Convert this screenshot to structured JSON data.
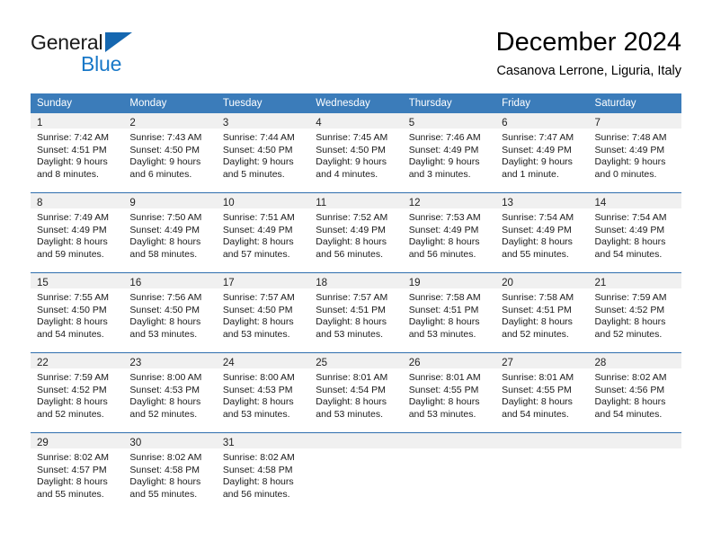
{
  "brand": {
    "word_one": "General",
    "word_two": "Blue",
    "triangle_icon": "triangle-logo-icon",
    "color_dark": "#1a1a1a",
    "color_blue": "#1878c8",
    "color_triangle": "#1567b0"
  },
  "header": {
    "title": "December 2024",
    "subtitle": "Casanova Lerrone, Liguria, Italy"
  },
  "theme": {
    "header_bg": "#3b7cba",
    "header_text": "#ffffff",
    "daynum_band_bg": "#f0f0f0",
    "row_divider": "#2f6fae",
    "cell_bg": "#ffffff"
  },
  "calendar": {
    "weekday_headers": [
      "Sunday",
      "Monday",
      "Tuesday",
      "Wednesday",
      "Thursday",
      "Friday",
      "Saturday"
    ],
    "weeks": [
      [
        {
          "day": "1",
          "sunrise": "Sunrise: 7:42 AM",
          "sunset": "Sunset: 4:51 PM",
          "daylight": "Daylight: 9 hours and 8 minutes."
        },
        {
          "day": "2",
          "sunrise": "Sunrise: 7:43 AM",
          "sunset": "Sunset: 4:50 PM",
          "daylight": "Daylight: 9 hours and 6 minutes."
        },
        {
          "day": "3",
          "sunrise": "Sunrise: 7:44 AM",
          "sunset": "Sunset: 4:50 PM",
          "daylight": "Daylight: 9 hours and 5 minutes."
        },
        {
          "day": "4",
          "sunrise": "Sunrise: 7:45 AM",
          "sunset": "Sunset: 4:50 PM",
          "daylight": "Daylight: 9 hours and 4 minutes."
        },
        {
          "day": "5",
          "sunrise": "Sunrise: 7:46 AM",
          "sunset": "Sunset: 4:49 PM",
          "daylight": "Daylight: 9 hours and 3 minutes."
        },
        {
          "day": "6",
          "sunrise": "Sunrise: 7:47 AM",
          "sunset": "Sunset: 4:49 PM",
          "daylight": "Daylight: 9 hours and 1 minute."
        },
        {
          "day": "7",
          "sunrise": "Sunrise: 7:48 AM",
          "sunset": "Sunset: 4:49 PM",
          "daylight": "Daylight: 9 hours and 0 minutes."
        }
      ],
      [
        {
          "day": "8",
          "sunrise": "Sunrise: 7:49 AM",
          "sunset": "Sunset: 4:49 PM",
          "daylight": "Daylight: 8 hours and 59 minutes."
        },
        {
          "day": "9",
          "sunrise": "Sunrise: 7:50 AM",
          "sunset": "Sunset: 4:49 PM",
          "daylight": "Daylight: 8 hours and 58 minutes."
        },
        {
          "day": "10",
          "sunrise": "Sunrise: 7:51 AM",
          "sunset": "Sunset: 4:49 PM",
          "daylight": "Daylight: 8 hours and 57 minutes."
        },
        {
          "day": "11",
          "sunrise": "Sunrise: 7:52 AM",
          "sunset": "Sunset: 4:49 PM",
          "daylight": "Daylight: 8 hours and 56 minutes."
        },
        {
          "day": "12",
          "sunrise": "Sunrise: 7:53 AM",
          "sunset": "Sunset: 4:49 PM",
          "daylight": "Daylight: 8 hours and 56 minutes."
        },
        {
          "day": "13",
          "sunrise": "Sunrise: 7:54 AM",
          "sunset": "Sunset: 4:49 PM",
          "daylight": "Daylight: 8 hours and 55 minutes."
        },
        {
          "day": "14",
          "sunrise": "Sunrise: 7:54 AM",
          "sunset": "Sunset: 4:49 PM",
          "daylight": "Daylight: 8 hours and 54 minutes."
        }
      ],
      [
        {
          "day": "15",
          "sunrise": "Sunrise: 7:55 AM",
          "sunset": "Sunset: 4:50 PM",
          "daylight": "Daylight: 8 hours and 54 minutes."
        },
        {
          "day": "16",
          "sunrise": "Sunrise: 7:56 AM",
          "sunset": "Sunset: 4:50 PM",
          "daylight": "Daylight: 8 hours and 53 minutes."
        },
        {
          "day": "17",
          "sunrise": "Sunrise: 7:57 AM",
          "sunset": "Sunset: 4:50 PM",
          "daylight": "Daylight: 8 hours and 53 minutes."
        },
        {
          "day": "18",
          "sunrise": "Sunrise: 7:57 AM",
          "sunset": "Sunset: 4:51 PM",
          "daylight": "Daylight: 8 hours and 53 minutes."
        },
        {
          "day": "19",
          "sunrise": "Sunrise: 7:58 AM",
          "sunset": "Sunset: 4:51 PM",
          "daylight": "Daylight: 8 hours and 53 minutes."
        },
        {
          "day": "20",
          "sunrise": "Sunrise: 7:58 AM",
          "sunset": "Sunset: 4:51 PM",
          "daylight": "Daylight: 8 hours and 52 minutes."
        },
        {
          "day": "21",
          "sunrise": "Sunrise: 7:59 AM",
          "sunset": "Sunset: 4:52 PM",
          "daylight": "Daylight: 8 hours and 52 minutes."
        }
      ],
      [
        {
          "day": "22",
          "sunrise": "Sunrise: 7:59 AM",
          "sunset": "Sunset: 4:52 PM",
          "daylight": "Daylight: 8 hours and 52 minutes."
        },
        {
          "day": "23",
          "sunrise": "Sunrise: 8:00 AM",
          "sunset": "Sunset: 4:53 PM",
          "daylight": "Daylight: 8 hours and 52 minutes."
        },
        {
          "day": "24",
          "sunrise": "Sunrise: 8:00 AM",
          "sunset": "Sunset: 4:53 PM",
          "daylight": "Daylight: 8 hours and 53 minutes."
        },
        {
          "day": "25",
          "sunrise": "Sunrise: 8:01 AM",
          "sunset": "Sunset: 4:54 PM",
          "daylight": "Daylight: 8 hours and 53 minutes."
        },
        {
          "day": "26",
          "sunrise": "Sunrise: 8:01 AM",
          "sunset": "Sunset: 4:55 PM",
          "daylight": "Daylight: 8 hours and 53 minutes."
        },
        {
          "day": "27",
          "sunrise": "Sunrise: 8:01 AM",
          "sunset": "Sunset: 4:55 PM",
          "daylight": "Daylight: 8 hours and 54 minutes."
        },
        {
          "day": "28",
          "sunrise": "Sunrise: 8:02 AM",
          "sunset": "Sunset: 4:56 PM",
          "daylight": "Daylight: 8 hours and 54 minutes."
        }
      ],
      [
        {
          "day": "29",
          "sunrise": "Sunrise: 8:02 AM",
          "sunset": "Sunset: 4:57 PM",
          "daylight": "Daylight: 8 hours and 55 minutes."
        },
        {
          "day": "30",
          "sunrise": "Sunrise: 8:02 AM",
          "sunset": "Sunset: 4:58 PM",
          "daylight": "Daylight: 8 hours and 55 minutes."
        },
        {
          "day": "31",
          "sunrise": "Sunrise: 8:02 AM",
          "sunset": "Sunset: 4:58 PM",
          "daylight": "Daylight: 8 hours and 56 minutes."
        },
        {
          "day": "",
          "sunrise": "",
          "sunset": "",
          "daylight": ""
        },
        {
          "day": "",
          "sunrise": "",
          "sunset": "",
          "daylight": ""
        },
        {
          "day": "",
          "sunrise": "",
          "sunset": "",
          "daylight": ""
        },
        {
          "day": "",
          "sunrise": "",
          "sunset": "",
          "daylight": ""
        }
      ]
    ]
  }
}
